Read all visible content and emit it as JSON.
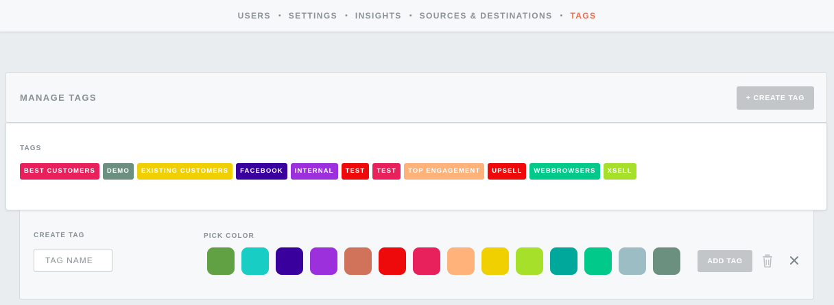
{
  "nav": {
    "items": [
      {
        "label": "USERS",
        "active": false
      },
      {
        "label": "SETTINGS",
        "active": false
      },
      {
        "label": "INSIGHTS",
        "active": false
      },
      {
        "label": "SOURCES & DESTINATIONS",
        "active": false
      },
      {
        "label": "TAGS",
        "active": true
      }
    ],
    "separator": "•",
    "active_color": "#f06a4d"
  },
  "manage": {
    "title": "MANAGE TAGS",
    "create_button_label": "+ CREATE TAG"
  },
  "tags": {
    "label": "TAGS",
    "items": [
      {
        "label": "BEST CUSTOMERS",
        "color": "#e8205c"
      },
      {
        "label": "DEMO",
        "color": "#6b9080"
      },
      {
        "label": "EXISTING CUSTOMERS",
        "color": "#f0d000"
      },
      {
        "label": "FACEBOOK",
        "color": "#3a009e"
      },
      {
        "label": "INTERNAL",
        "color": "#9b30dc"
      },
      {
        "label": "TEST",
        "color": "#ee0a0a"
      },
      {
        "label": "TEST",
        "color": "#e8205c"
      },
      {
        "label": "TOP ENGAGEMENT",
        "color": "#ffb27a"
      },
      {
        "label": "UPSELL",
        "color": "#ee0a0a"
      },
      {
        "label": "WEBBROWSERS",
        "color": "#00c98a"
      },
      {
        "label": "XSELL",
        "color": "#a6e02a"
      }
    ]
  },
  "create": {
    "label": "CREATE TAG",
    "input_placeholder": "TAG NAME",
    "input_value": "",
    "pick_color_label": "PICK COLOR",
    "colors": [
      "#62a044",
      "#18cec4",
      "#3a009e",
      "#9b30dc",
      "#d0735a",
      "#ee0a0a",
      "#e8205c",
      "#ffb27a",
      "#f0d000",
      "#a6e02a",
      "#00a89b",
      "#00c98a",
      "#9bbdc3",
      "#6b9080"
    ],
    "add_button_label": "ADD TAG",
    "icons": {
      "delete": "trash-icon",
      "close": "close-icon"
    }
  }
}
